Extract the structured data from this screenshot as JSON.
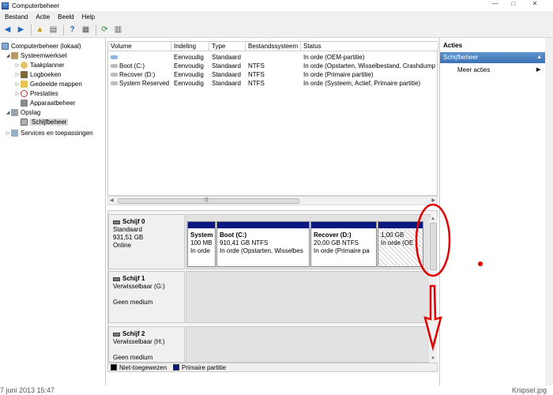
{
  "window": {
    "title": "Computerbeheer"
  },
  "menu": [
    "Bestand",
    "Actie",
    "Beeld",
    "Help"
  ],
  "tree": {
    "root": "Computerbeheer (lokaal)",
    "items": [
      "Systeemwerkset",
      "Taakplanner",
      "Logboeken",
      "Gedeelde mappen",
      "Prestaties",
      "Apparaatbeheer",
      "Opslag",
      "Schijfbeheer",
      "Services en toepassingen"
    ]
  },
  "volumes": {
    "columns": [
      "Volume",
      "Indeling",
      "Type",
      "Bestandssysteem",
      "Status"
    ],
    "rows": [
      [
        "",
        "Eenvoudig",
        "Standaard",
        "",
        "In orde (OEM-partitie)"
      ],
      [
        "Boot (C:)",
        "Eenvoudig",
        "Standaard",
        "NTFS",
        "In orde (Opstarten, Wisselbestand, Crashdump"
      ],
      [
        "Recover (D:)",
        "Eenvoudig",
        "Standaard",
        "NTFS",
        "In orde (Primaire partitie)"
      ],
      [
        "System Reserved",
        "Eenvoudig",
        "Standaard",
        "NTFS",
        "In orde (Systeem, Actief, Primaire partitie)"
      ]
    ]
  },
  "disks": [
    {
      "name": "Schijf 0",
      "lines": [
        "Standaard",
        "931,51 GB",
        "Online"
      ]
    },
    {
      "name": "Schijf 1",
      "lines": [
        "Verwisselbaar (G:)",
        "",
        "Geen medium"
      ]
    },
    {
      "name": "Schijf 2",
      "lines": [
        "Verwisselbaar (H:)",
        "",
        "Geen medium"
      ]
    }
  ],
  "partitions": [
    {
      "name": "System",
      "size": "100 MB",
      "status": "In orde"
    },
    {
      "name": "Boot  (C:)",
      "size": "910,41 GB NTFS",
      "status": "In orde (Opstarten, Wisselbes"
    },
    {
      "name": "Recover  (D:)",
      "size": "20,00 GB NTFS",
      "status": "In orde (Primaire pa"
    },
    {
      "name": "",
      "size": "1,00 GB",
      "status": "In orde (OE"
    }
  ],
  "legend": [
    "Niet-toegewezen",
    "Primaire partitie"
  ],
  "legend_colors": [
    "#000000",
    "#0a1a82"
  ],
  "actions": {
    "header": "Acties",
    "section": "Schijfbeheer",
    "item": "Meer acties"
  },
  "footer": {
    "left": "7 juni 2013 15:47",
    "right": "Knipsel.jpg"
  },
  "annotation_color": "#e00000"
}
